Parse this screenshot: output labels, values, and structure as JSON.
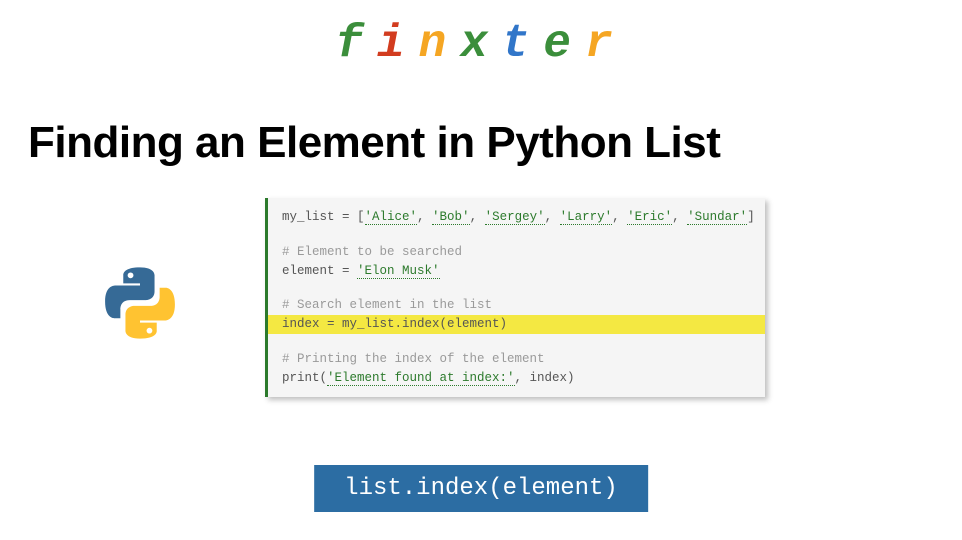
{
  "logo": {
    "letters": [
      "f",
      "i",
      "n",
      "x",
      "t",
      "e",
      "r"
    ]
  },
  "title": "Finding an Element in Python List",
  "code": {
    "line1_a": "my_list = [",
    "line1_s1": "'Alice'",
    "line1_c1": ", ",
    "line1_s2": "'Bob'",
    "line1_c2": ", ",
    "line1_s3": "'Sergey'",
    "line1_c3": ", ",
    "line1_s4": "'Larry'",
    "line1_c4": ", ",
    "line1_s5": "'Eric'",
    "line1_c5": ", ",
    "line1_s6": "'Sundar'",
    "line1_b": "]",
    "line2": "# Element to be searched",
    "line3_a": "element = ",
    "line3_s": "'Elon Musk'",
    "line4": "# Search element in the list",
    "line5": "index = my_list.index(element)",
    "line6": "# Printing the index of the element",
    "line7_a": "print(",
    "line7_s": "'Element found at index:'",
    "line7_b": ", index)"
  },
  "syntax": "list.index(element)"
}
